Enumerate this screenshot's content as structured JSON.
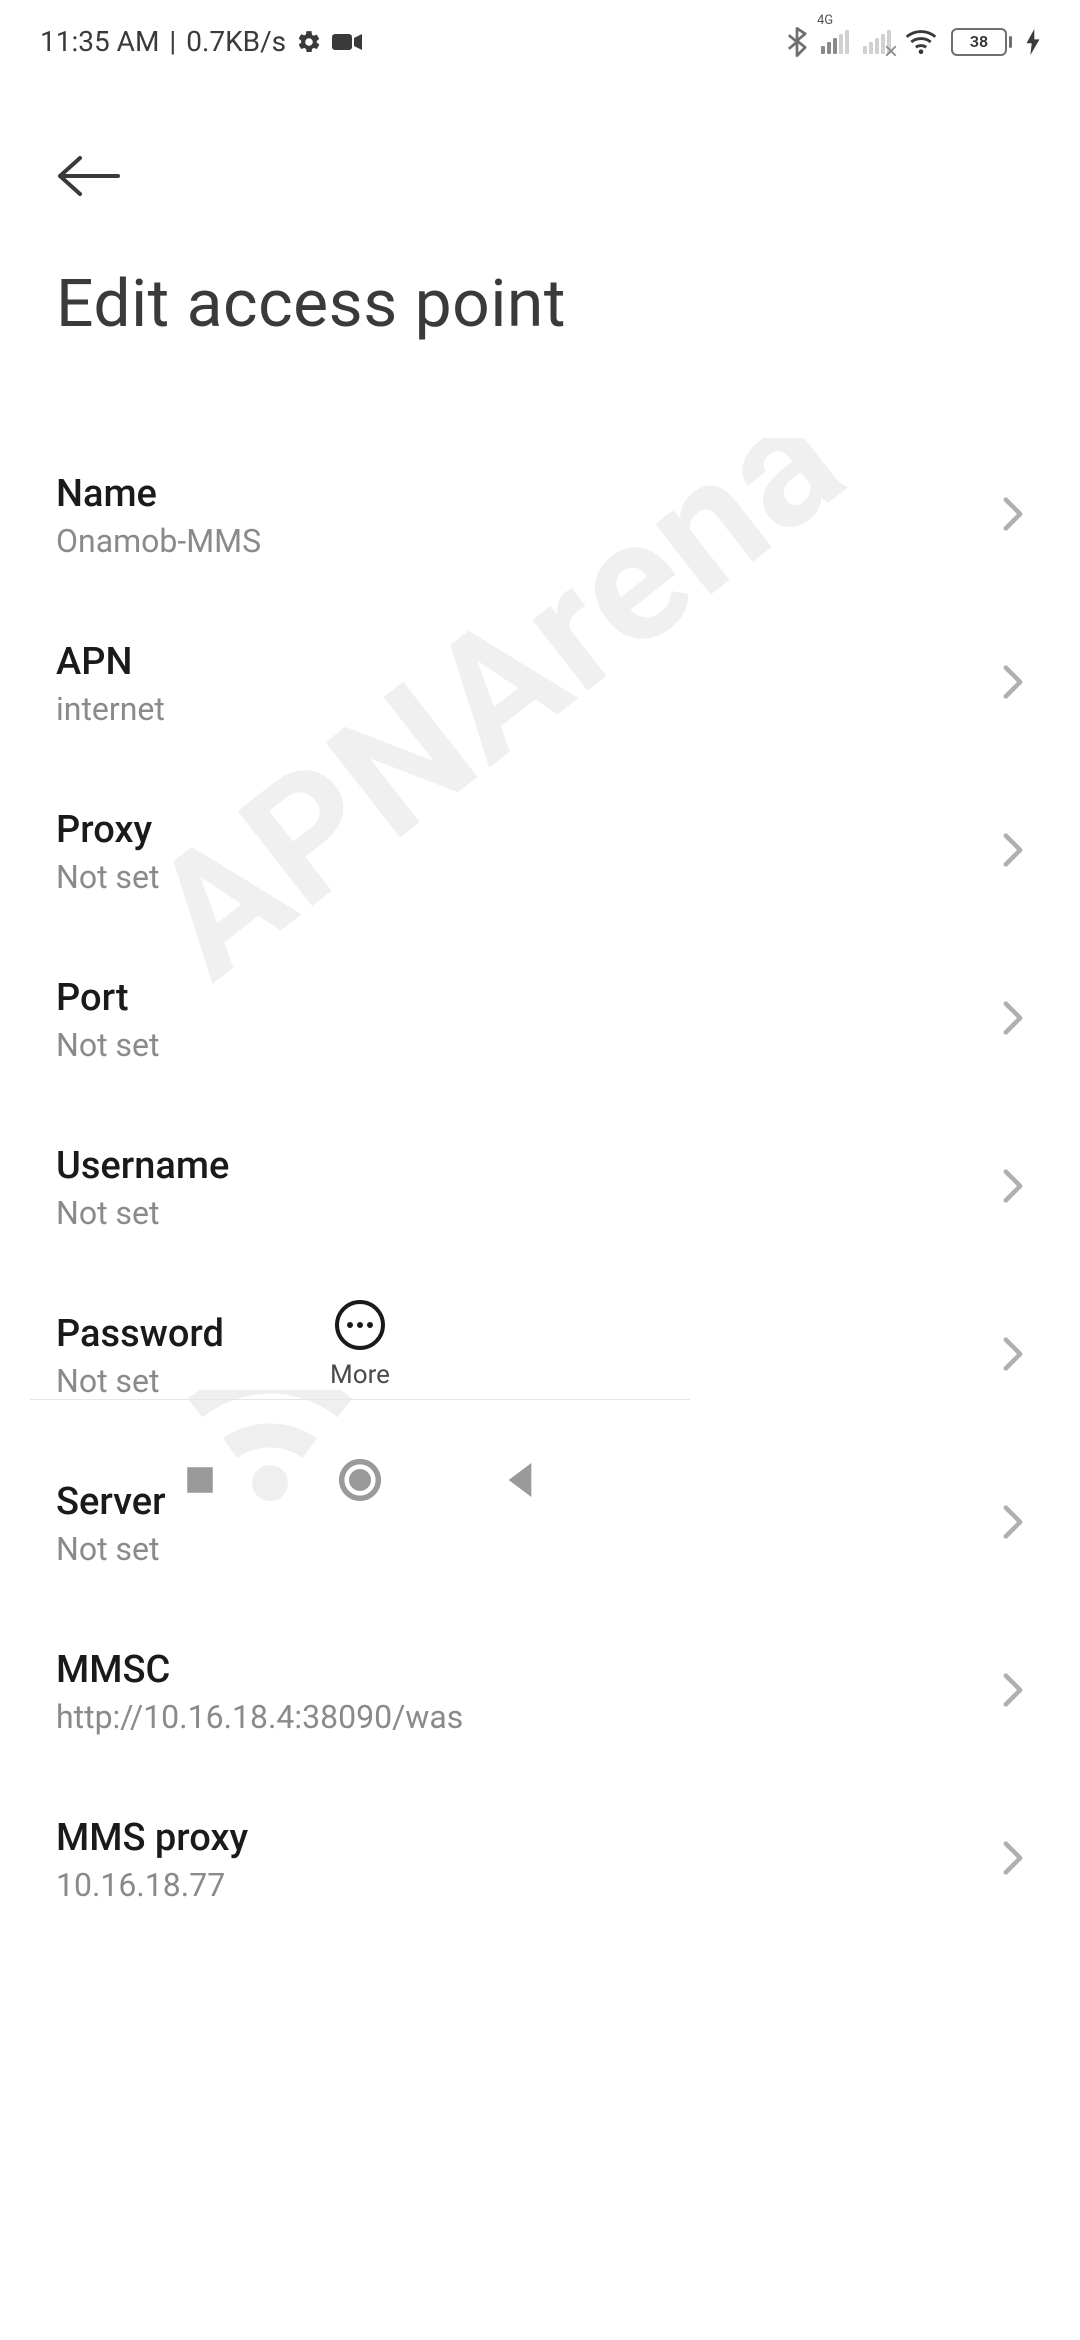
{
  "status_bar": {
    "time": "11:35 AM",
    "separator": "|",
    "network_speed": "0.7KB/s",
    "signal_label": "4G",
    "battery_pct": "38"
  },
  "header": {
    "page_title": "Edit access point"
  },
  "settings": [
    {
      "label": "Name",
      "value": "Onamob-MMS"
    },
    {
      "label": "APN",
      "value": "internet"
    },
    {
      "label": "Proxy",
      "value": "Not set"
    },
    {
      "label": "Port",
      "value": "Not set"
    },
    {
      "label": "Username",
      "value": "Not set"
    },
    {
      "label": "Password",
      "value": "Not set"
    },
    {
      "label": "Server",
      "value": "Not set"
    },
    {
      "label": "MMSC",
      "value": "http://10.16.18.4:38090/was"
    },
    {
      "label": "MMS proxy",
      "value": "10.16.18.77"
    }
  ],
  "bottom_action": {
    "more_label": "More"
  },
  "watermark": {
    "text": "APNArena"
  }
}
